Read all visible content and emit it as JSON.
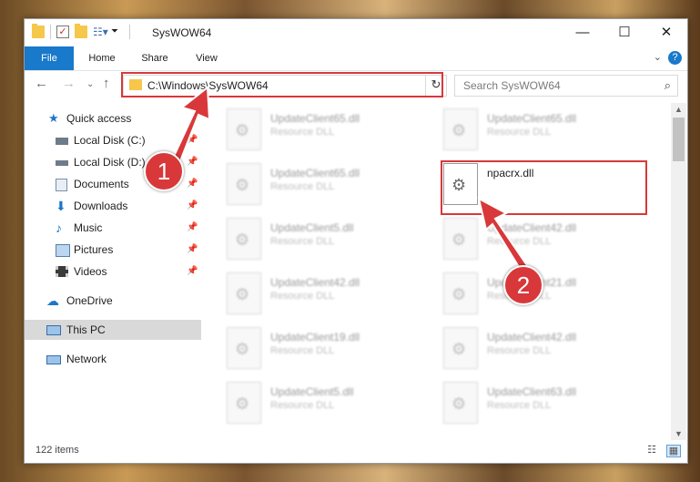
{
  "window": {
    "title": "SysWOW64",
    "minimize": "—",
    "maximize": "☐",
    "close": "✕"
  },
  "ribbon": {
    "tabs": [
      "File",
      "Home",
      "Share",
      "View"
    ],
    "help": "?"
  },
  "address": {
    "path": "C:\\Windows\\SysWOW64",
    "search_placeholder": "Search SysWOW64"
  },
  "sidebar": {
    "items": [
      {
        "label": "Quick access",
        "icon": "star-icon"
      },
      {
        "label": "Local Disk (C:)",
        "icon": "drive-icon",
        "pinned": true
      },
      {
        "label": "Local Disk (D:)",
        "icon": "drive-icon",
        "pinned": true
      },
      {
        "label": "Documents",
        "icon": "documents-icon",
        "pinned": true
      },
      {
        "label": "Downloads",
        "icon": "download-icon",
        "pinned": true
      },
      {
        "label": "Music",
        "icon": "music-icon",
        "pinned": true
      },
      {
        "label": "Pictures",
        "icon": "pictures-icon",
        "pinned": true
      },
      {
        "label": "Videos",
        "icon": "video-icon",
        "pinned": true
      },
      {
        "label": "OneDrive",
        "icon": "cloud-icon"
      },
      {
        "label": "This PC",
        "icon": "computer-icon",
        "selected": true
      },
      {
        "label": "Network",
        "icon": "network-icon"
      }
    ]
  },
  "files": {
    "left": [
      {
        "name": "UpdateClient65.dll",
        "type": "Resource DLL"
      },
      {
        "name": "UpdateClient65.dll",
        "type": "Resource DLL"
      },
      {
        "name": "UpdateClient5.dll",
        "type": "Resource DLL"
      },
      {
        "name": "UpdateClient42.dll",
        "type": "Resource DLL"
      },
      {
        "name": "UpdateClient19.dll",
        "type": "Resource DLL"
      },
      {
        "name": "UpdateClient5.dll",
        "type": "Resource DLL"
      }
    ],
    "right": [
      {
        "name": "UpdateClient65.dll",
        "type": "Resource DLL"
      },
      {
        "name": "npacrx.dll",
        "type": "",
        "highlighted": true
      },
      {
        "name": "UpdateClient42.dll",
        "type": "Resource DLL"
      },
      {
        "name": "UpdateClient21.dll",
        "type": "Resource DLL"
      },
      {
        "name": "UpdateClient42.dll",
        "type": "Resource DLL"
      },
      {
        "name": "UpdateClient63.dll",
        "type": "Resource DLL"
      }
    ]
  },
  "status": {
    "item_count": "122 items"
  },
  "annotations": {
    "callout_1": "1",
    "callout_2": "2",
    "color": "#d8383a"
  }
}
